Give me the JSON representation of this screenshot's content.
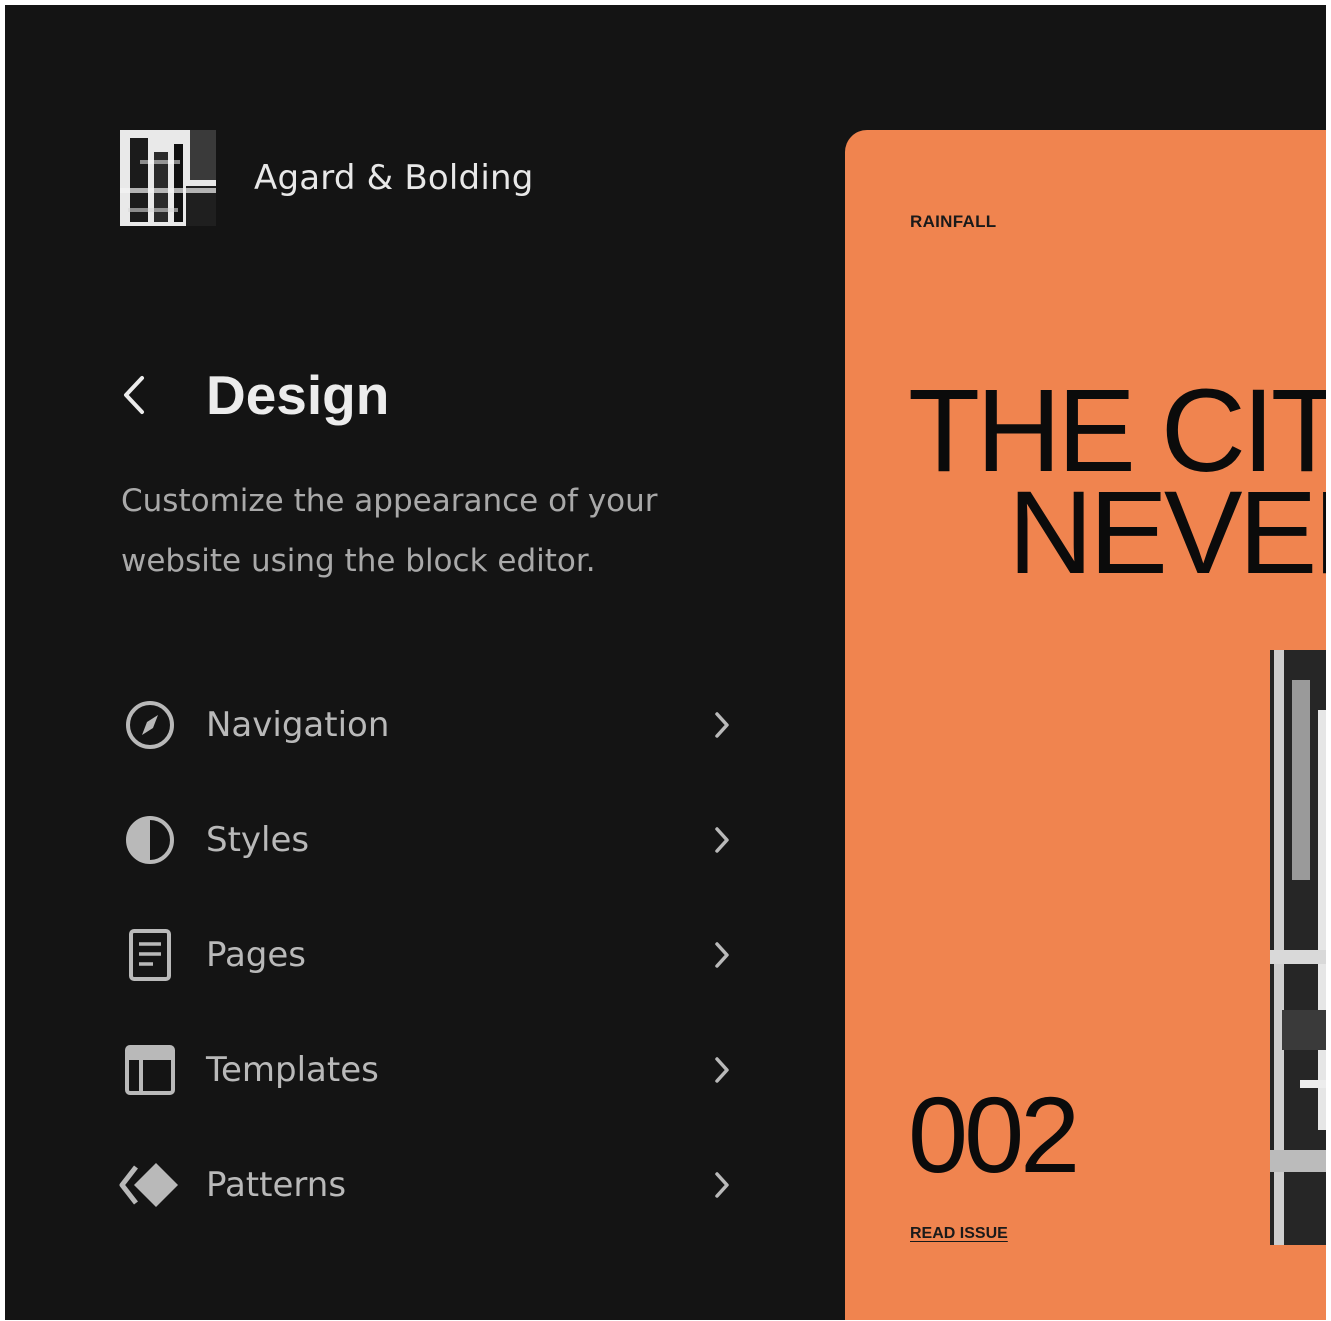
{
  "site": {
    "title": "Agard & Bolding",
    "logo_icon": "site-logo-image"
  },
  "panel": {
    "back_icon": "chevron-left-icon",
    "title": "Design",
    "description": "Customize the appearance of your website using the block editor."
  },
  "nav": {
    "items": [
      {
        "label": "Navigation",
        "icon": "compass-icon",
        "chevron": "chevron-right-icon"
      },
      {
        "label": "Styles",
        "icon": "half-circle-icon",
        "chevron": "chevron-right-icon"
      },
      {
        "label": "Pages",
        "icon": "page-icon",
        "chevron": "chevron-right-icon"
      },
      {
        "label": "Templates",
        "icon": "layout-icon",
        "chevron": "chevron-right-icon"
      },
      {
        "label": "Patterns",
        "icon": "diamond-icon",
        "chevron": "chevron-right-icon"
      }
    ]
  },
  "preview": {
    "kicker": "RAINFALL",
    "headline_line1": "THE CITY",
    "headline_line2": "NEVER",
    "issue_number": "002",
    "link_label": "READ ISSUE"
  },
  "colors": {
    "sidebar_background": "#141414",
    "text_primary": "#ececec",
    "text_secondary": "#a9a9a9",
    "preview_accent": "#f0844f"
  }
}
